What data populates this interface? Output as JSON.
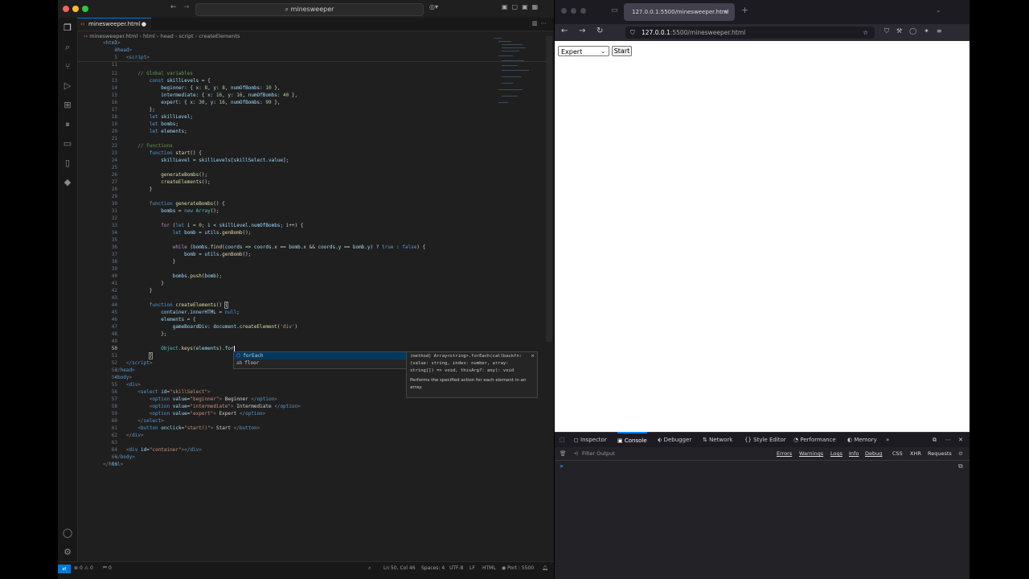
{
  "vscode": {
    "command_center": "minesweeper",
    "tab_label": "minesweeper.html",
    "breadcrumbs": [
      "minesweeper.html",
      "html",
      "head",
      "script",
      "createElements"
    ],
    "line_numbers": [
      "2",
      "3",
      "5",
      "11",
      "12",
      "13",
      "14",
      "15",
      "16",
      "17",
      "18",
      "19",
      "20",
      "21",
      "22",
      "23",
      "24",
      "25",
      "26",
      "27",
      "28",
      "29",
      "30",
      "31",
      "32",
      "33",
      "34",
      "35",
      "36",
      "37",
      "38",
      "39",
      "40",
      "41",
      "42",
      "43",
      "44",
      "45",
      "46",
      "47",
      "48",
      "49",
      "50",
      "51",
      "52",
      "53",
      "54",
      "55",
      "56",
      "57",
      "58",
      "59",
      "60",
      "61",
      "62",
      "63",
      "64",
      "65",
      "66"
    ],
    "suggest": {
      "items": [
        {
          "label": "forEach",
          "icon": "method-icon"
        },
        {
          "label": "floor",
          "icon": "text-icon"
        }
      ],
      "doc_signature": "(method) Array<string>.forEach(callbackfn: (value: string, index: number, array: string[]) => void, thisArg?: any): void",
      "doc_description": "Performs the specified action for each element in an array."
    },
    "status": {
      "problems": "0",
      "warnings": "0",
      "ports": "0",
      "position": "Ln 50, Col 46",
      "spaces": "Spaces: 4",
      "encoding": "UTF-8",
      "eol": "LF",
      "language": "HTML",
      "port": "Port : 5500"
    }
  },
  "firefox": {
    "tab_title": "127.0.0.1:5500/minesweeper.html",
    "url_host": "127.0.0.1",
    "url_rest": ":5500/minesweeper.html",
    "page": {
      "select_value": "Expert",
      "start_label": "Start"
    },
    "devtools": {
      "tabs": [
        "Inspector",
        "Console",
        "Debugger",
        "Network",
        "Style Editor",
        "Performance",
        "Memory"
      ],
      "active_tab": "Console",
      "filter_placeholder": "Filter Output",
      "filters": [
        "Errors",
        "Warnings",
        "Logs",
        "Info",
        "Debug"
      ],
      "extra_filters": [
        "CSS",
        "XHR",
        "Requests"
      ]
    }
  }
}
